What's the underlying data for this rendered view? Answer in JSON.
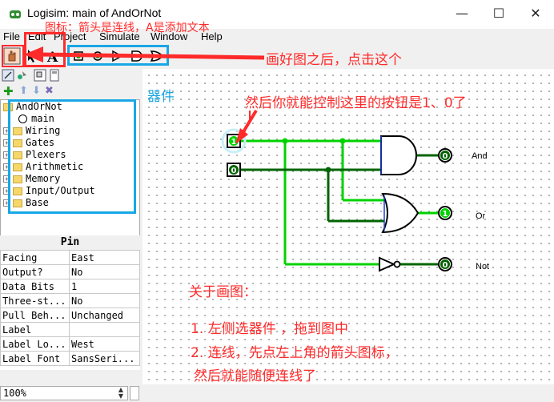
{
  "window": {
    "title": "Logisim: main of AndOrNot",
    "minimize": "—",
    "maximize": "☐",
    "close": "✕"
  },
  "menu": {
    "file": "File",
    "edit": "Edit",
    "project": "Project",
    "simulate": "Simulate",
    "window": "Window",
    "help": "Help"
  },
  "explorer": {
    "root": "AndOrNot",
    "main": "main",
    "libraries": [
      "Wiring",
      "Gates",
      "Plexers",
      "Arithmetic",
      "Memory",
      "Input/Output",
      "Base"
    ]
  },
  "properties": {
    "title": "Pin",
    "rows": [
      {
        "key": "Facing",
        "value": "East"
      },
      {
        "key": "Output?",
        "value": "No"
      },
      {
        "key": "Data Bits",
        "value": "1"
      },
      {
        "key": "Three-st...",
        "value": "No"
      },
      {
        "key": "Pull Beh...",
        "value": "Unchanged"
      },
      {
        "key": "Label",
        "value": ""
      },
      {
        "key": "Label Lo...",
        "value": "West"
      },
      {
        "key": "Label Font",
        "value": "SansSeri..."
      }
    ]
  },
  "status": {
    "zoom": "100%"
  },
  "circuit": {
    "input1": "1",
    "input2": "0",
    "out_and": "0",
    "out_or": "1",
    "out_not": "0",
    "label_and": "And",
    "label_or": "Or",
    "label_not": "Not"
  },
  "annotations": {
    "toolbar_icon_note": "图标：箭头是连线，A是添加文本",
    "click_this": "画好图之后，点击这个",
    "components": "器件",
    "control_buttons": "然后你就能控制这里的按钮是1、0了",
    "drawing_title": "关于画图：",
    "step1": "1. 左侧选器件 ，拖到图中",
    "step2": "2. 连线，先点左上角的箭头图标，",
    "step3": "然后就能随便连线了"
  },
  "colors": {
    "wire_on": "#00d200",
    "wire_off": "#006400",
    "annotation_red": "#ff2a2a",
    "annotation_cyan": "#19a7e6"
  }
}
